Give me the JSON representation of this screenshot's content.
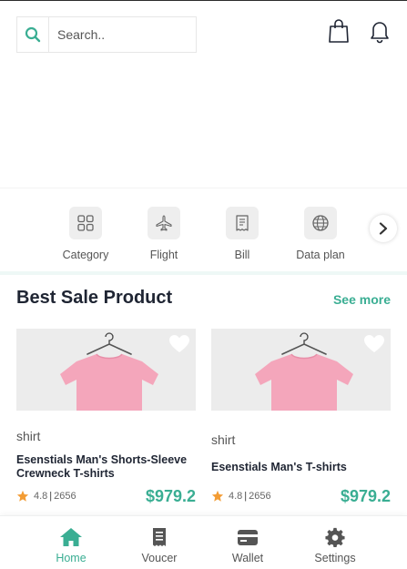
{
  "search": {
    "placeholder": "Search.."
  },
  "categories": [
    {
      "label": "Category",
      "icon": "grid-icon"
    },
    {
      "label": "Flight",
      "icon": "airplane-icon"
    },
    {
      "label": "Bill",
      "icon": "receipt-icon"
    },
    {
      "label": "Data plan",
      "icon": "globe-icon"
    }
  ],
  "section": {
    "title": "Best Sale Product",
    "see_more": "See more"
  },
  "products": [
    {
      "category": "shirt",
      "title": "Esenstials Man's Shorts-Sleeve Crewneck T-shirts",
      "rating": "4.8",
      "reviews": "2656",
      "price": "$979.2"
    },
    {
      "category": "shirt",
      "title": "Esenstials Man's T-shirts",
      "rating": "4.8",
      "reviews": "2656",
      "price": "$979.2"
    }
  ],
  "nav": [
    {
      "label": "Home",
      "icon": "home-icon",
      "active": true
    },
    {
      "label": "Voucer",
      "icon": "voucher-icon",
      "active": false
    },
    {
      "label": "Wallet",
      "icon": "wallet-icon",
      "active": false
    },
    {
      "label": "Settings",
      "icon": "gear-icon",
      "active": false
    }
  ],
  "colors": {
    "accent": "#3aae93",
    "star": "#f39c34",
    "shirt": "#f4a6bb"
  }
}
